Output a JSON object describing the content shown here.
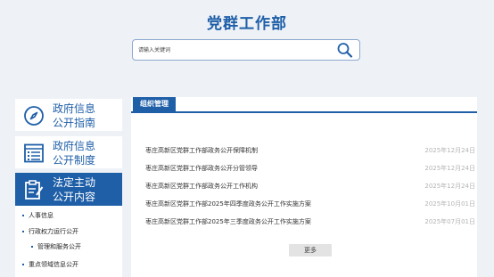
{
  "header": {
    "title": "党群工作部"
  },
  "search": {
    "placeholder": "请输入关键词",
    "icon": "search-icon"
  },
  "sidebar": {
    "items": [
      {
        "line1": "政府信息",
        "line2": "公开指南",
        "icon": "compass-icon",
        "active": false
      },
      {
        "line1": "政府信息",
        "line2": "公开制度",
        "icon": "list-document-icon",
        "active": false
      },
      {
        "line1": "法定主动",
        "line2": "公开内容",
        "icon": "clipboard-edit-icon",
        "active": true
      }
    ],
    "sub_items": [
      {
        "label": "人事信息"
      },
      {
        "label": "行政权力运行公开"
      },
      {
        "label": "管理和服务公开"
      },
      {
        "label": "重点领域信息公开"
      }
    ]
  },
  "main": {
    "tab_label": "组织管理",
    "rows": [
      {
        "title": "枣庄高新区党群工作部政务公开保障机制",
        "date": "2025年12月24日"
      },
      {
        "title": "枣庄高新区党群工作部政务公开分管领导",
        "date": "2025年12月24日"
      },
      {
        "title": "枣庄高新区党群工作部政务公开工作机构",
        "date": "2025年12月24日"
      },
      {
        "title": "枣庄高新区党群工作部2025年四季度政务公开工作实施方案",
        "date": "2025年10月01日"
      },
      {
        "title": "枣庄高新区党群工作部2025年三季度政务公开工作实施方案",
        "date": "2025年07月01日"
      }
    ],
    "more_label": "更多"
  },
  "colors": {
    "accent": "#1f5fa8",
    "date": "#b4b4b4",
    "background": "#eef2f7"
  }
}
